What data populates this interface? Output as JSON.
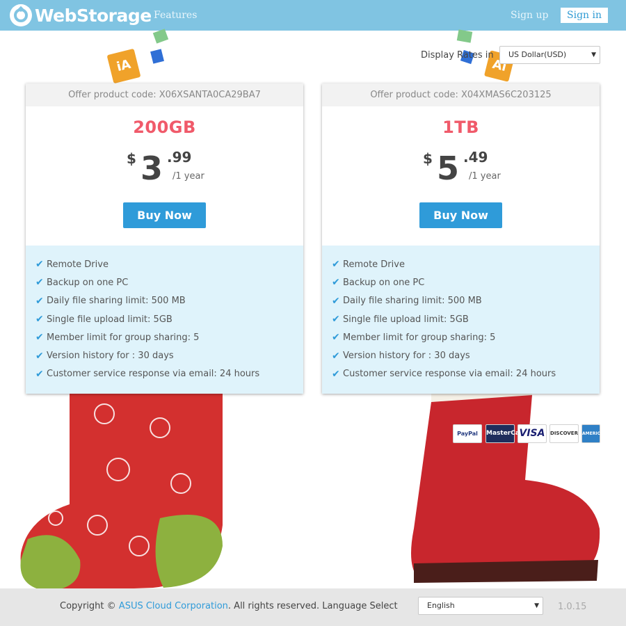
{
  "header": {
    "brand": "WebStorage",
    "nav_features": "Features",
    "sign_up": "Sign up",
    "sign_in": "Sign in"
  },
  "decor": {
    "tag_left": "iA",
    "tag_right": "Ai"
  },
  "rates": {
    "label": "Display Rates in",
    "selected": "US Dollar(USD)"
  },
  "plans": [
    {
      "offer_code": "Offer product code: X06XSANTA0CA29BA7",
      "size": "200GB",
      "currency": "$",
      "price_main": "3",
      "price_cents": ".99",
      "period": "/1 year",
      "buy_label": "Buy Now",
      "features": [
        "Remote Drive",
        "Backup on one PC",
        "Daily file sharing limit: 500 MB",
        "Single file upload limit: 5GB",
        "Member limit for group sharing: 5",
        "Version history for : 30 days",
        "Customer service response via email: 24 hours"
      ]
    },
    {
      "offer_code": "Offer product code: X04XMAS6C203125",
      "size": "1TB",
      "currency": "$",
      "price_main": "5",
      "price_cents": ".49",
      "period": "/1 year",
      "buy_label": "Buy Now",
      "features": [
        "Remote Drive",
        "Backup on one PC",
        "Daily file sharing limit: 500 MB",
        "Single file upload limit: 5GB",
        "Member limit for group sharing: 5",
        "Version history for : 30 days",
        "Customer service response via email: 24 hours"
      ]
    }
  ],
  "payment": {
    "paypal": "PayPal",
    "mastercard": "MasterCard",
    "visa": "VISA",
    "discover": "DISCOVER",
    "amex": "AMERICAN EXPRESS"
  },
  "footer": {
    "copyright_prefix": "Copyright ©",
    "company_link": "ASUS Cloud Corporation",
    "copyright_suffix": ". All rights reserved. Language Select",
    "language_selected": "English",
    "version": "1.0.15"
  },
  "colors": {
    "header_bg": "#80c4e2",
    "accent_blue": "#2f9bd9",
    "size_red": "#f05a6a",
    "feature_bg": "#dff3fb",
    "footer_bg": "#e6e6e6"
  },
  "icons": {
    "logo": "webstorage-logo-icon",
    "check": "check-icon",
    "dropdown": "chevron-down-icon"
  }
}
